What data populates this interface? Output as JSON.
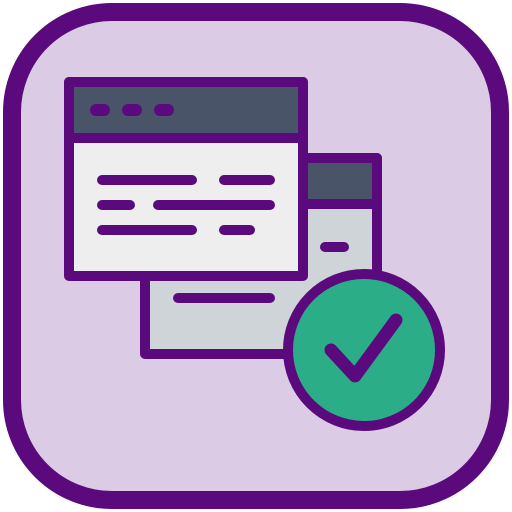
{
  "icon": {
    "name": "browser-windows-check-icon",
    "parts": [
      "rounded-square-background",
      "back-browser-window",
      "front-browser-window",
      "check-badge"
    ]
  },
  "colors": {
    "outline": "#5a0a7c",
    "background": "#dccbe4",
    "window_header": "#4a5468",
    "window_body_front": "#eeeeee",
    "window_body_back": "#cfd4d8",
    "header_dots": "#5a0a7c",
    "badge": "#2bae87",
    "checkmark": "#5a0a7c"
  }
}
